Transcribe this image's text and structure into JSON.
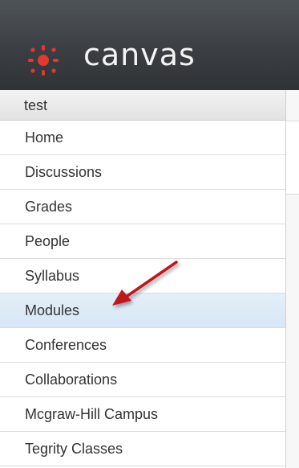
{
  "header": {
    "brand": "canvas",
    "logo_icon": "canvas-logo-icon",
    "brand_color": "#e2382e"
  },
  "course": {
    "title": "test"
  },
  "nav": {
    "items": [
      {
        "label": "Home"
      },
      {
        "label": "Discussions"
      },
      {
        "label": "Grades"
      },
      {
        "label": "People"
      },
      {
        "label": "Syllabus"
      },
      {
        "label": "Modules",
        "active": true
      },
      {
        "label": "Conferences"
      },
      {
        "label": "Collaborations"
      },
      {
        "label": "Mcgraw-Hill Campus"
      },
      {
        "label": "Tegrity Classes"
      }
    ]
  },
  "annotation": {
    "icon": "red-arrow-icon",
    "color": "#c0141b"
  }
}
